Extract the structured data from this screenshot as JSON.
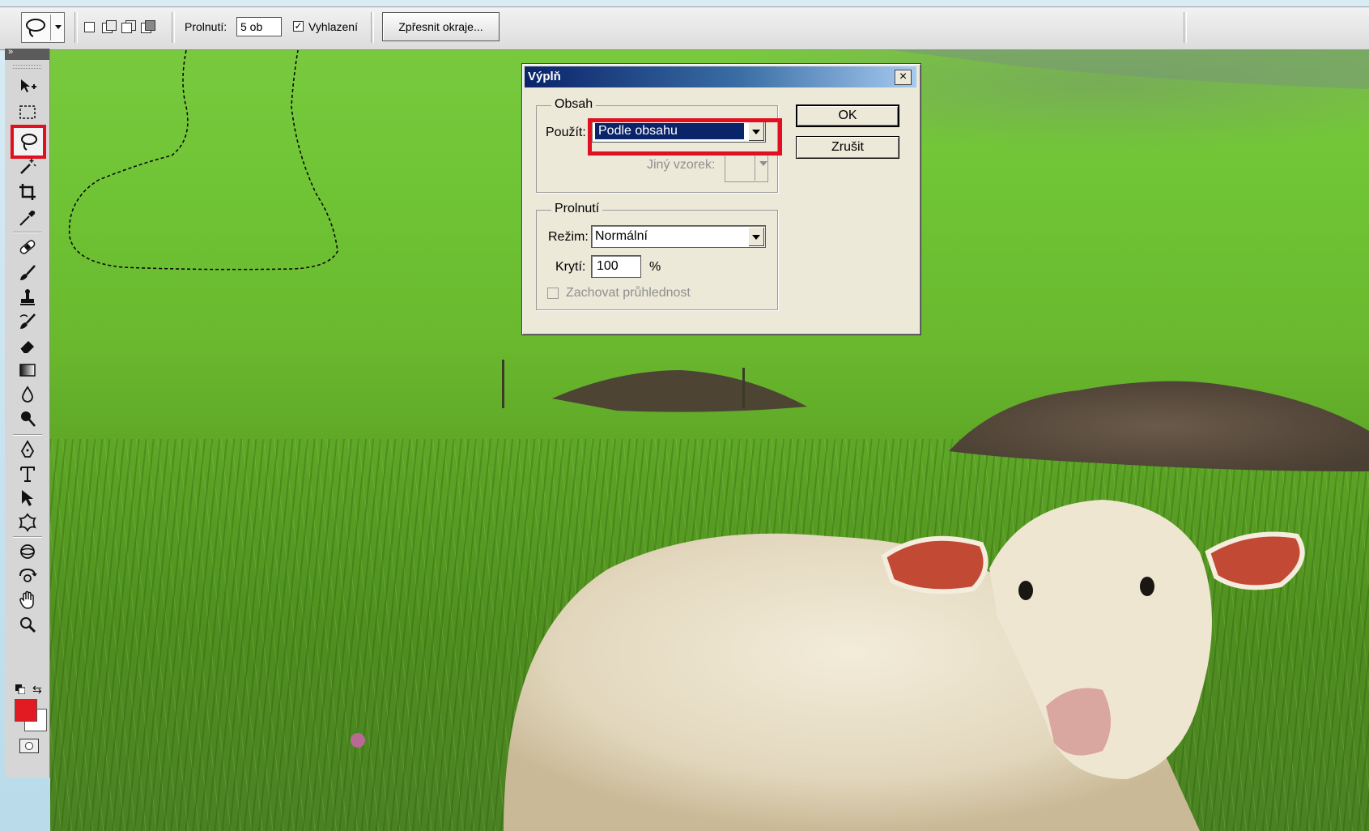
{
  "options_bar": {
    "feather_label": "Prolnutí:",
    "feather_value": "5 ob",
    "antialias_label": "Vyhlazení",
    "antialias_checked": true,
    "refine_edge_button": "Zpřesnit okraje..."
  },
  "toolbox": {
    "collapse_glyph": "»",
    "active_tool": "lasso-tool",
    "foreground_color": "#e21b23",
    "background_color": "#ffffff"
  },
  "dialog": {
    "title": "Výplň",
    "close_glyph": "×",
    "contents_group": {
      "legend": "Obsah",
      "use_label": "Použít:",
      "use_value": "Podle obsahu",
      "custom_pattern_label": "Jiný vzorek:"
    },
    "blending_group": {
      "legend": "Prolnutí",
      "mode_label": "Režim:",
      "mode_value": "Normální",
      "opacity_label": "Krytí:",
      "opacity_value": "100",
      "opacity_unit": "%",
      "preserve_transparency_label": "Zachovat průhlednost",
      "preserve_transparency_checked": false
    },
    "ok_button": "OK",
    "cancel_button": "Zrušit"
  },
  "highlight_color": "#e01020"
}
